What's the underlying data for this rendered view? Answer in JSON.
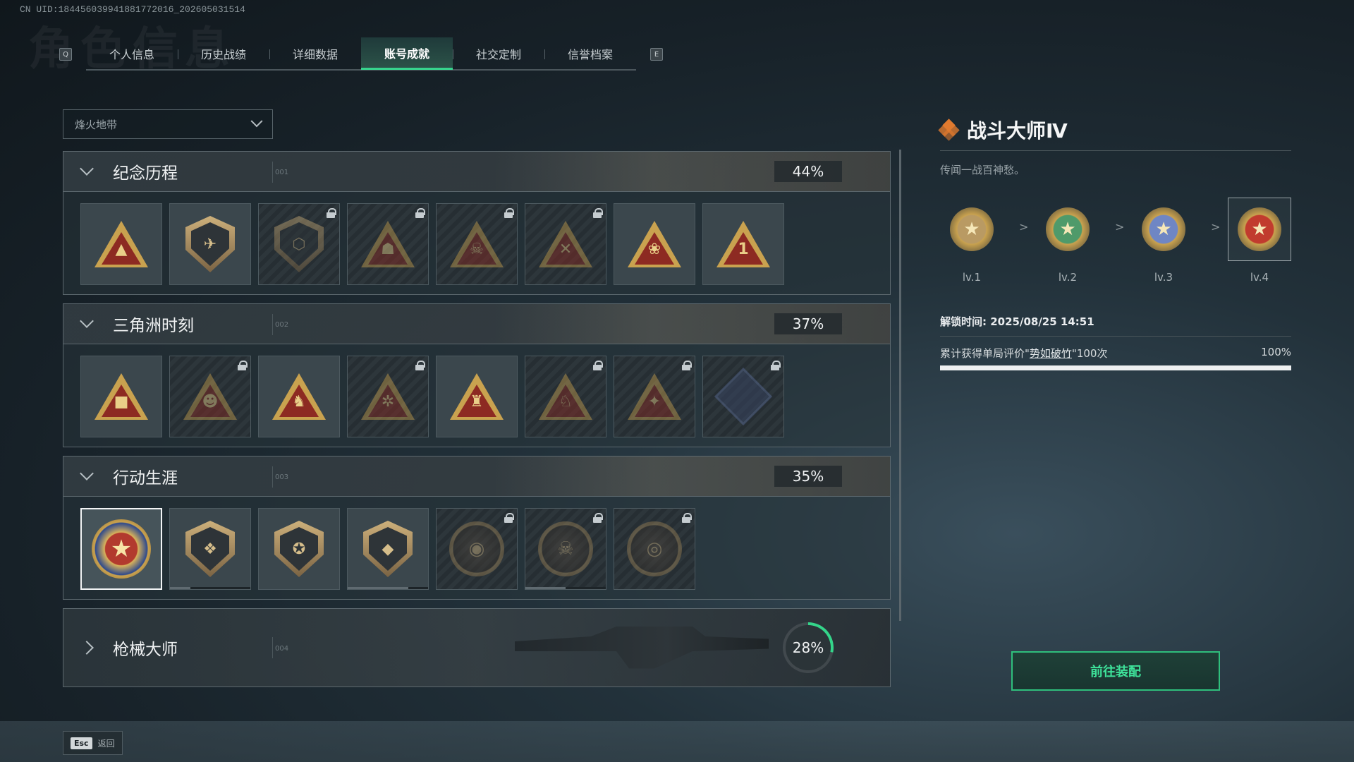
{
  "uid": "CN UID:18445603994188177201​6_202605031514",
  "tabs": {
    "left_key": "Q",
    "right_key": "E",
    "items": [
      "个人信息",
      "历史战绩",
      "详细数据",
      "账号成就",
      "社交定制",
      "信誉档案"
    ],
    "active": "账号成就"
  },
  "mode_select": {
    "value": "烽火地带"
  },
  "sections": [
    {
      "title": "纪念历程",
      "number": "001",
      "percent": "44%"
    },
    {
      "title": "三角洲时刻",
      "number": "002",
      "percent": "37%"
    },
    {
      "title": "行动生涯",
      "number": "003",
      "percent": "35%"
    },
    {
      "title": "枪械大师",
      "number": "004",
      "percent": "28%"
    }
  ],
  "badges": {
    "memorial": [
      {
        "icon": "delta-triangle-icon",
        "locked": false
      },
      {
        "icon": "helicopter-icon",
        "locked": false
      },
      {
        "icon": "hex-shield-icon",
        "locked": true
      },
      {
        "icon": "operator-icon",
        "locked": true
      },
      {
        "icon": "hooded-figure-icon",
        "locked": true
      },
      {
        "icon": "crossed-rifles-icon",
        "locked": true
      },
      {
        "icon": "lotus-triangle-icon",
        "locked": false
      },
      {
        "icon": "number-one-triangle-icon",
        "locked": false
      }
    ],
    "moments": [
      {
        "icon": "crate-triangle-icon",
        "locked": false
      },
      {
        "icon": "mask-triangle-icon",
        "locked": true
      },
      {
        "icon": "soldier-triangle-icon",
        "locked": false
      },
      {
        "icon": "gear-triangle-icon",
        "locked": true
      },
      {
        "icon": "squad-triangle-icon",
        "locked": false
      },
      {
        "icon": "beast-triangle-icon",
        "locked": true
      },
      {
        "icon": "bird-triangle-icon",
        "locked": true
      },
      {
        "icon": "crystal-diamond-icon",
        "locked": true
      }
    ],
    "career": [
      {
        "icon": "star-medal-icon",
        "locked": false,
        "selected": true
      },
      {
        "icon": "wing-shield-icon",
        "locked": false,
        "progress": 0.25
      },
      {
        "icon": "eagle-shield-icon",
        "locked": false
      },
      {
        "icon": "gem-shield-icon",
        "locked": false,
        "progress": 0.75
      },
      {
        "icon": "round-emblem-icon",
        "locked": true
      },
      {
        "icon": "skull-round-icon",
        "locked": true,
        "progress": 0.5
      },
      {
        "icon": "eye-round-icon",
        "locked": true
      }
    ]
  },
  "detail": {
    "title": "战斗大师Ⅳ",
    "description": "传闻一战百神愁。",
    "levels": [
      {
        "label": "lv.1",
        "color": "#b99a63"
      },
      {
        "label": "lv.2",
        "color": "#4f9a6a"
      },
      {
        "label": "lv.3",
        "color": "#6f86c4"
      },
      {
        "label": "lv.4",
        "color": "#c13b2e",
        "current": true
      }
    ],
    "arrow": ">",
    "unlock_time": "解锁时间: 2025/08/25 14:51",
    "condition_prefix": "累计获得单局评价\"",
    "condition_link": "势如破竹",
    "condition_suffix": "\"100次",
    "progress_text": "100%",
    "progress": 1.0,
    "equip_button": "前往装配"
  },
  "footer": {
    "esc_key": "Esc",
    "esc_label": "返回"
  },
  "colors": {
    "accent_green": "#37d48d",
    "title_orange": "#e07a2f"
  }
}
